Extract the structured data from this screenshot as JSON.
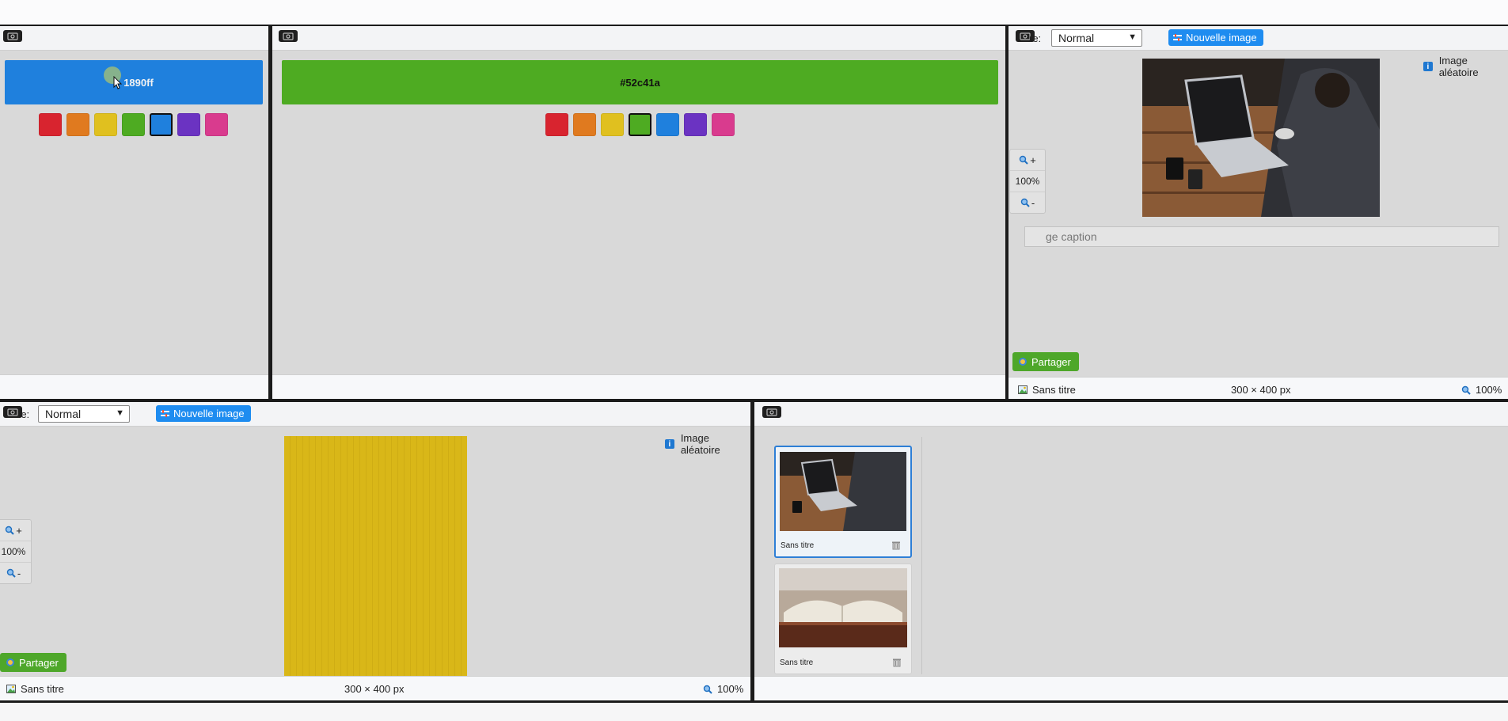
{
  "colors": {
    "accent_blue": "#1e8cf0",
    "share_green": "#4ea72a",
    "swatches": [
      "#d8242f",
      "#e07a1f",
      "#e0c01f",
      "#4eab22",
      "#1f80dd",
      "#6b33c2",
      "#d93b8e"
    ]
  },
  "pane1": {
    "color_value": "#1890ff",
    "color_label_visible": "1890ff",
    "selected_swatch": 4
  },
  "pane2": {
    "color_value": "#52c41a",
    "color_label": "#52c41a",
    "selected_swatch": 3
  },
  "pane3": {
    "mode_label": "re:",
    "mode_value": "Normal",
    "new_image_label": "Nouvelle image",
    "random_image_label": "Image aléatoire",
    "zoom_in_label": "+",
    "zoom_pct": "100%",
    "zoom_out_label": "-",
    "caption_placeholder": "ge caption",
    "share_label": "Partager",
    "footer_title": "Sans titre",
    "footer_dims": "300 × 400 px",
    "footer_zoom": "100%"
  },
  "pane4": {
    "mode_label": "re:",
    "mode_value": "Normal",
    "new_image_label": "Nouvelle image",
    "random_image_label": "Image aléatoire",
    "zoom_in_label": "+",
    "zoom_pct": "100%",
    "zoom_out_label": "-",
    "share_label": "Partager",
    "footer_title": "Sans titre",
    "footer_dims": "300 × 400 px",
    "footer_zoom": "100%"
  },
  "pane5": {
    "thumbnails": [
      {
        "label": "Sans titre",
        "subject": "laptop-photo",
        "active": true
      },
      {
        "label": "Sans titre",
        "subject": "open-book-photo",
        "active": false
      }
    ]
  }
}
